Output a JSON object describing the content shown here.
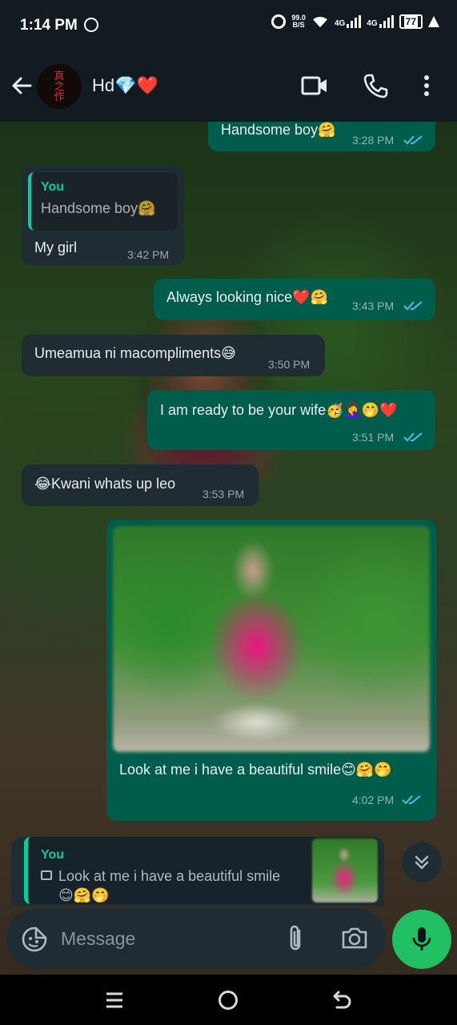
{
  "status_bar": {
    "time": "1:14 PM",
    "net_speed_value": "99.0",
    "net_speed_unit": "B/S",
    "network_1": "4G",
    "network_2": "4G",
    "battery": "77"
  },
  "header": {
    "contact_name": "Hd💎❤️",
    "avatar_text": "真\n之\n作"
  },
  "messages": [
    {
      "id": 0,
      "direction": "out",
      "text": "Handsome boy🤗",
      "time": "3:28 PM",
      "read": true
    },
    {
      "id": 1,
      "direction": "in",
      "quote_author": "You",
      "quote_text": "Handsome boy🤗",
      "text": "My girl",
      "time": "3:42 PM"
    },
    {
      "id": 2,
      "direction": "out",
      "text": "Always looking nice❤️🤗",
      "time": "3:43 PM",
      "read": true
    },
    {
      "id": 3,
      "direction": "in",
      "text": "Umeamua ni macompliments😅",
      "time": "3:50 PM"
    },
    {
      "id": 4,
      "direction": "out",
      "text": "I am ready to be your wife🥳🤦‍♀️🤭❤️",
      "time": "3:51 PM",
      "read": true
    },
    {
      "id": 5,
      "direction": "in",
      "text": "😂Kwani whats up leo",
      "time": "3:53 PM"
    },
    {
      "id": 6,
      "direction": "out",
      "has_image": true,
      "text": "Look at me i have a beautiful smile😊🤗🤭",
      "time": "4:02 PM",
      "read": true
    }
  ],
  "reply_preview": {
    "author": "You",
    "text": "Look at me i have a beautiful smile 😊🤗🤭"
  },
  "input": {
    "placeholder": "Message"
  },
  "colors": {
    "outgoing_bubble": "#005c4b",
    "incoming_bubble": "#202c33",
    "accent": "#06cf9c",
    "read_ticks": "#53bdeb",
    "mic_button": "#21c063"
  },
  "icons": [
    "back-arrow-icon",
    "video-call-icon",
    "voice-call-icon",
    "more-options-icon",
    "sticker-icon",
    "attach-icon",
    "camera-icon",
    "mic-icon",
    "scroll-down-icon",
    "image-icon",
    "double-check-icon"
  ]
}
